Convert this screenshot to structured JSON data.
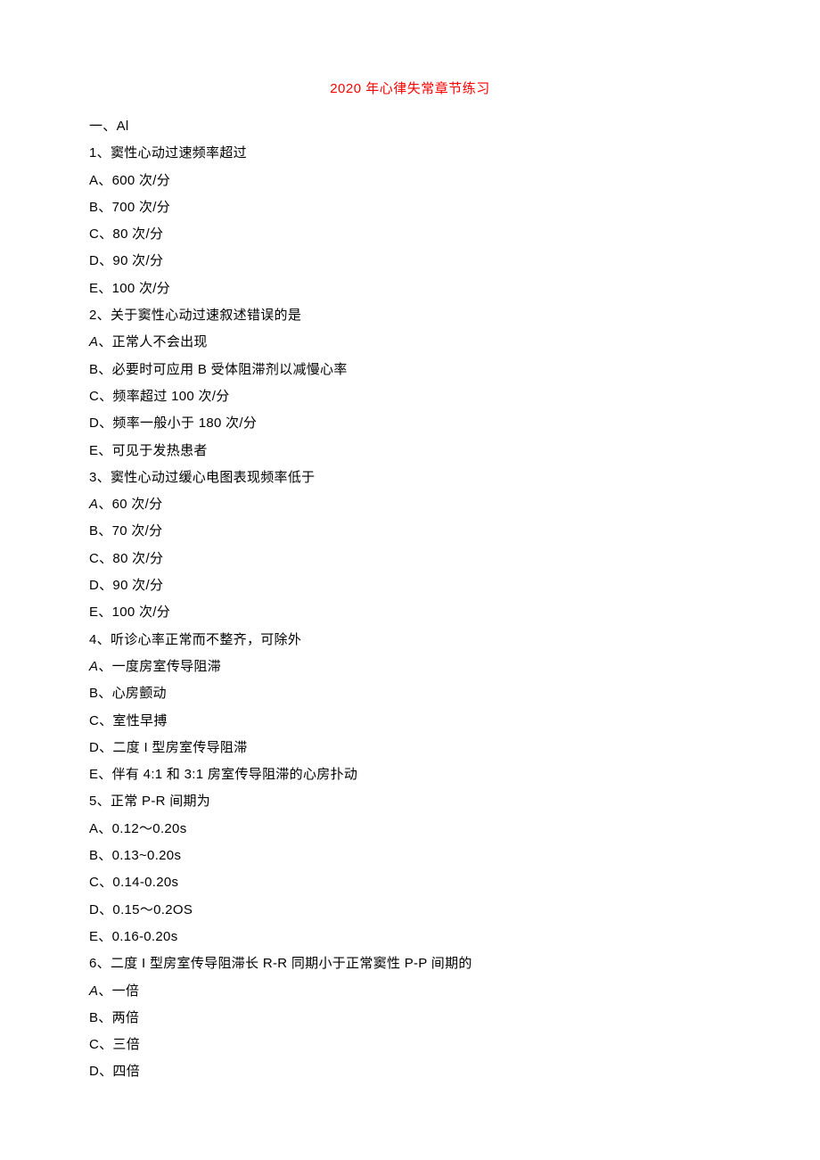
{
  "title": "2020 年心律失常章节练习",
  "lines": [
    {
      "text": "一、Al"
    },
    {
      "text": "1、窦性心动过速频率超过"
    },
    {
      "text": "A、600 次/分"
    },
    {
      "text": "B、700 次/分"
    },
    {
      "text": "C、80 次/分"
    },
    {
      "text": "D、90 次/分"
    },
    {
      "text": "E、100 次/分"
    },
    {
      "text": "2、关于窦性心动过速叙述错误的是"
    },
    {
      "prefix": "A",
      "prefixItalic": true,
      "rest": "、正常人不会出现"
    },
    {
      "text": "B、必要时可应用 B 受体阻滞剂以减慢心率"
    },
    {
      "text": "C、频率超过 100 次/分"
    },
    {
      "text": "D、频率一般小于 180 次/分"
    },
    {
      "text": "E、可见于发热患者"
    },
    {
      "text": "3、窦性心动过缓心电图表现频率低于"
    },
    {
      "prefix": "A",
      "prefixItalic": true,
      "rest": "、60 次/分"
    },
    {
      "text": "B、70 次/分"
    },
    {
      "text": "C、80 次/分"
    },
    {
      "text": "D、90 次/分"
    },
    {
      "text": "E、100 次/分"
    },
    {
      "text": "4、听诊心率正常而不整齐，可除外"
    },
    {
      "prefix": "A",
      "prefixItalic": true,
      "rest": "、一度房室传导阻滞"
    },
    {
      "text": "B、心房颤动"
    },
    {
      "text": "C、室性早搏"
    },
    {
      "text": "D、二度 I 型房室传导阻滞"
    },
    {
      "text": "E、伴有 4:1 和 3:1 房室传导阻滞的心房扑动"
    },
    {
      "text": "5、正常 P-R 间期为"
    },
    {
      "text": "A、0.12～0.20s"
    },
    {
      "text": "B、0.13~0.20s"
    },
    {
      "text": "C、0.14-0.20s"
    },
    {
      "text": "D、0.15～0.2OS"
    },
    {
      "text": "E、0.16-0.20s"
    },
    {
      "text": "6、二度 I 型房室传导阻滞长 R-R 同期小于正常窦性 P-P 间期的"
    },
    {
      "prefix": "A",
      "prefixItalic": true,
      "rest": "、一倍"
    },
    {
      "text": "B、两倍"
    },
    {
      "text": "C、三倍"
    },
    {
      "text": "D、四倍"
    }
  ]
}
